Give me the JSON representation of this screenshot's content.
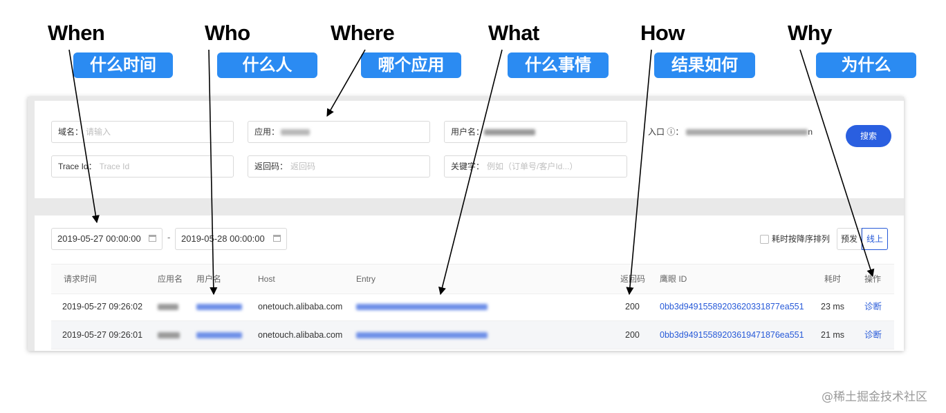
{
  "headings": [
    {
      "en": "When",
      "zh": "什么时间"
    },
    {
      "en": "Who",
      "zh": "什么人"
    },
    {
      "en": "Where",
      "zh": "哪个应用"
    },
    {
      "en": "What",
      "zh": "什么事情"
    },
    {
      "en": "How",
      "zh": "结果如何"
    },
    {
      "en": "Why",
      "zh": "为什么"
    }
  ],
  "search": {
    "domain_label": "域名：",
    "domain_placeholder": "请输入",
    "app_label": "应用：",
    "user_label": "用户名：",
    "entry_label": "入口 ⓘ：",
    "entry_suffix": "n",
    "traceid_label": "Trace Id：",
    "traceid_placeholder": "Trace Id",
    "retcode_label": "返回码：",
    "retcode_placeholder": "返回码",
    "keyword_label": "关键字：",
    "keyword_placeholder": "例如（订单号/客户Id...）",
    "search_button": "搜索"
  },
  "filters": {
    "start_date": "2019-05-27 00:00:00",
    "separator": "-",
    "end_date": "2019-05-28 00:00:00",
    "sort_checkbox_label": "耗时按降序排列",
    "env_pre": "预发",
    "env_online": "线上"
  },
  "table": {
    "columns": [
      "请求时间",
      "应用名",
      "用户名",
      "Host",
      "Entry",
      "返回码",
      "鹰眼 ID",
      "耗时",
      "操作"
    ],
    "rows": [
      {
        "time": "2019-05-27 09:26:02",
        "host": "onetouch.alibaba.com",
        "code": "200",
        "trace_id": "0bb3d94915589203620331877ea551",
        "cost": "23 ms",
        "action": "诊断"
      },
      {
        "time": "2019-05-27 09:26:01",
        "host": "onetouch.alibaba.com",
        "code": "200",
        "trace_id": "0bb3d94915589203619471876ea551",
        "cost": "21 ms",
        "action": "诊断"
      }
    ]
  },
  "watermark": "@稀土掘金技术社区",
  "colors": {
    "pill": "#2b8bf2",
    "primary_button": "#2a5fe0",
    "link": "#2659d8"
  }
}
